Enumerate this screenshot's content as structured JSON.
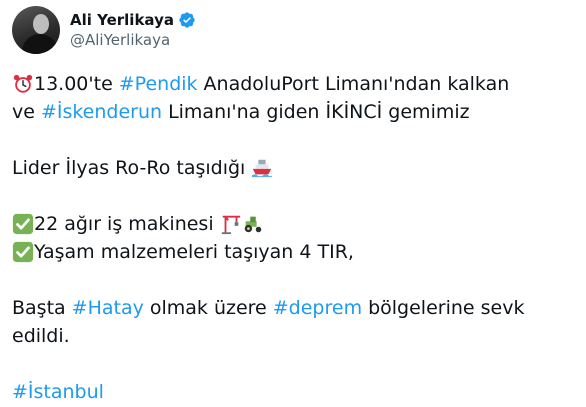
{
  "author": {
    "display_name": "Ali Yerlikaya",
    "handle": "@AliYerlikaya"
  },
  "tweet": {
    "line1": {
      "time": "13.00'te",
      "tag_pendik": "#Pendik",
      "rest": "AnadoluPort Limanı'ndan kalkan"
    },
    "line2": {
      "prefix": "ve",
      "tag_iskenderun": "#İskenderun",
      "rest": "Limanı'na giden İKİNCİ gemimiz"
    },
    "line3": "Lider İlyas Ro-Ro taşıdığı",
    "line4": "22 ağır iş makinesi",
    "line5": "Yaşam malzemeleri taşıyan 4 TIR,",
    "line6": {
      "prefix": "Başta",
      "tag_hatay": "#Hatay",
      "middle": "olmak üzere",
      "tag_deprem": "#deprem",
      "rest": "bölgelerine sevk"
    },
    "line7": "edildi.",
    "line8_tag": "#İstanbul"
  },
  "colors": {
    "link": "#1d9bf0",
    "verified": "#1d9bf0",
    "text": "#0f1419",
    "secondary": "#536471"
  },
  "icons": [
    "verified-badge-icon",
    "alarm-clock-icon",
    "ship-icon",
    "check-mark-icon",
    "crane-icon",
    "tractor-icon"
  ]
}
